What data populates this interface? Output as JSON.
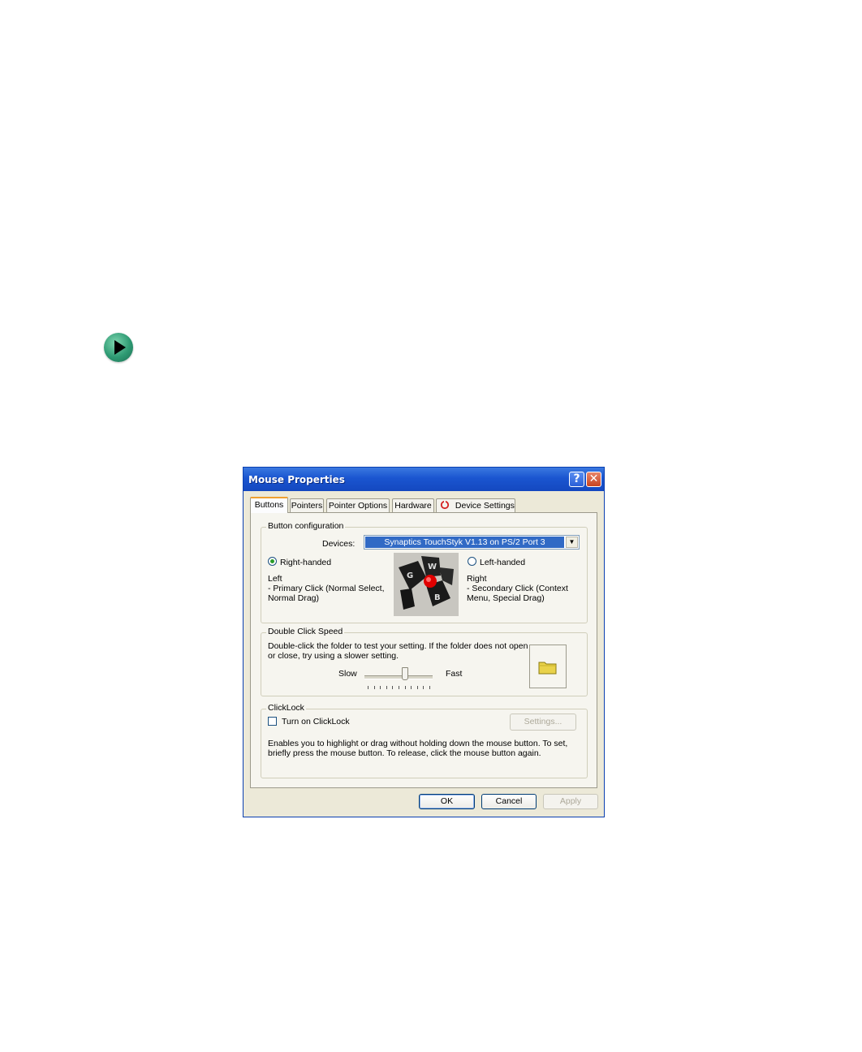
{
  "window": {
    "title": "Mouse Properties",
    "help_glyph": "?",
    "close_glyph": "✕"
  },
  "tabs": [
    "Buttons",
    "Pointers",
    "Pointer Options",
    "Hardware",
    "Device Settings"
  ],
  "active_tab": "Buttons",
  "button_config": {
    "group_label": "Button configuration",
    "devices_label": "Devices:",
    "device_value": "Synaptics TouchStyk V1.13 on PS/2 Port 3",
    "right_handed_label": "Right-handed",
    "right_handed_selected": true,
    "left_handed_label": "Left-handed",
    "left_handed_selected": false,
    "left_title": "Left",
    "left_desc_1": "- Primary Click (Normal Select,",
    "left_desc_2": "Normal Drag)",
    "right_title": "Right",
    "right_desc_1": "- Secondary Click (Context",
    "right_desc_2": "Menu, Special Drag)",
    "button_letters": [
      "G",
      "W",
      "B"
    ]
  },
  "double_click": {
    "group_label": "Double Click Speed",
    "desc_1": "Double-click the folder to test your setting.  If the folder does not open",
    "desc_2": "or close, try using a slower setting.",
    "slow_label": "Slow",
    "fast_label": "Fast",
    "speed_fraction": 0.6
  },
  "clicklock": {
    "group_label": "ClickLock",
    "checkbox_label": "Turn on ClickLock",
    "checked": false,
    "settings_label": "Settings...",
    "desc_1": "Enables you to highlight or drag without holding down the mouse button.  To set,",
    "desc_2": "briefly press the mouse button.  To release, click the mouse button again."
  },
  "footer": {
    "ok_label": "OK",
    "cancel_label": "Cancel",
    "apply_label": "Apply"
  },
  "colors": {
    "titlebar": "#1a55d0",
    "selection": "#316ac5",
    "active_tab_accent": "#f0a030",
    "bullet": "#2e9a73"
  },
  "icons": {
    "bullet": "play-arrow-icon",
    "device_settings_tab": "synaptics-icon",
    "folder": "folder-icon"
  }
}
